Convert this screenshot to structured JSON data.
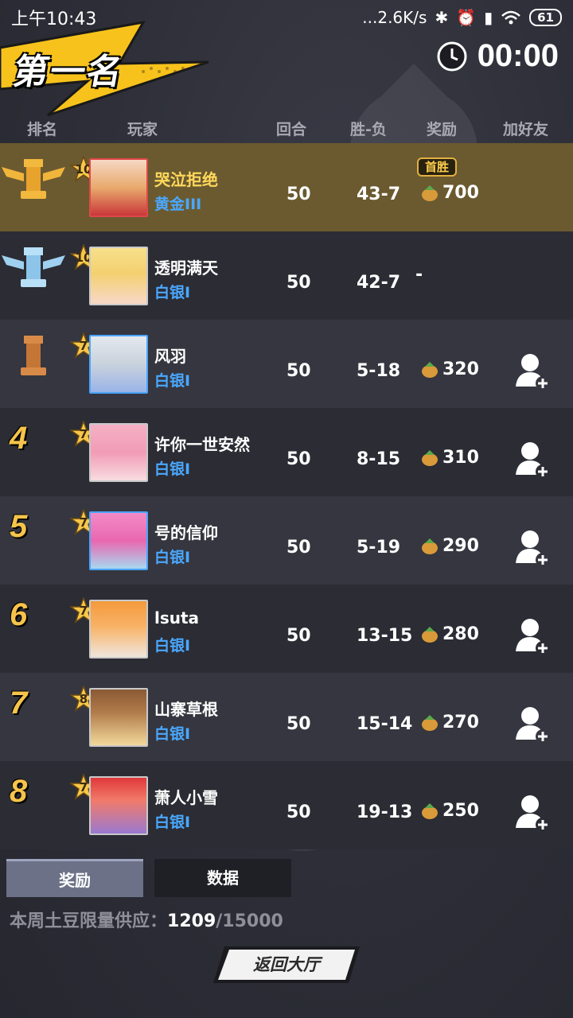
{
  "status_bar": {
    "time": "上午10:43",
    "network": "...2.6K/s",
    "battery": "61"
  },
  "header": {
    "rank_title": "第一名",
    "timer": "00:00"
  },
  "columns": {
    "rank": "排名",
    "player": "玩家",
    "rounds": "回合",
    "win_loss": "胜-负",
    "reward": "奖励",
    "add_friend": "加好友"
  },
  "rows": [
    {
      "rank": "1",
      "rank_icon": "gold-chess-rook-icon",
      "level": "10",
      "name": "哭泣拒绝",
      "tier": "黄金III",
      "rounds": "50",
      "win_loss": "43-7",
      "reward": "700",
      "badge": "首胜",
      "add_friend": false
    },
    {
      "rank": "2",
      "rank_icon": "silver-chess-rook-icon",
      "level": "10",
      "name": "透明满天",
      "tier": "白银I",
      "rounds": "50",
      "win_loss": "42-7",
      "reward": "-",
      "add_friend": false
    },
    {
      "rank": "3",
      "rank_icon": "bronze-chess-rook-icon",
      "level": "7",
      "name": "风羽",
      "tier": "白银I",
      "rounds": "50",
      "win_loss": "5-18",
      "reward": "320",
      "add_friend": true
    },
    {
      "rank": "4",
      "level": "7",
      "name": "许你一世安然",
      "tier": "白银I",
      "rounds": "50",
      "win_loss": "8-15",
      "reward": "310",
      "add_friend": true
    },
    {
      "rank": "5",
      "level": "7",
      "name": "号的信仰",
      "tier": "白银I",
      "rounds": "50",
      "win_loss": "5-19",
      "reward": "290",
      "add_friend": true
    },
    {
      "rank": "6",
      "level": "7",
      "name": "lsuta",
      "tier": "白银I",
      "rounds": "50",
      "win_loss": "13-15",
      "reward": "280",
      "add_friend": true
    },
    {
      "rank": "7",
      "level": "8",
      "name": "山寨草根",
      "tier": "白银I",
      "rounds": "50",
      "win_loss": "15-14",
      "reward": "270",
      "add_friend": true
    },
    {
      "rank": "8",
      "level": "7",
      "name": "萧人小雪",
      "tier": "白银I",
      "rounds": "50",
      "win_loss": "19-13",
      "reward": "250",
      "add_friend": true
    }
  ],
  "tabs": {
    "reward": "奖励",
    "data": "数据"
  },
  "supply": {
    "label": "本周土豆限量供应：",
    "current": "1209",
    "total": "/15000"
  },
  "back_button": "返回大厅"
}
